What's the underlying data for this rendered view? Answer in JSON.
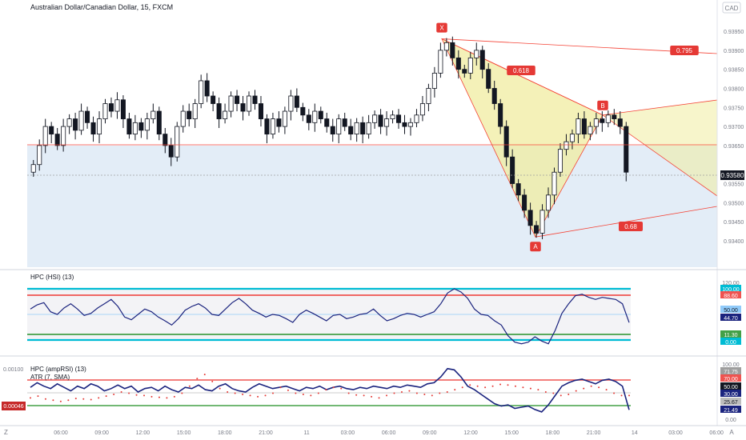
{
  "header": {
    "symbol_title": "Australian Dollar/Canadian Dollar, 15, FXCM",
    "currency": "CAD"
  },
  "main_pane": {
    "y_ticks": [
      "0.93950",
      "0.93900",
      "0.93850",
      "0.93800",
      "0.93750",
      "0.93700",
      "0.93650",
      "0.93550",
      "0.93500",
      "0.93450",
      "0.93400"
    ],
    "last_price": "0.93580",
    "pattern_points": {
      "X": "X",
      "A": "A",
      "B": "B"
    },
    "ratios": {
      "xab": "0.618",
      "c1": "0.795",
      "c2": "0.68"
    }
  },
  "hsi_pane": {
    "title": "HPC (HSI) (13)",
    "labels": [
      "120.00",
      "100.00",
      "88.60",
      "50.00",
      "44.70",
      "11.30",
      "0.00"
    ]
  },
  "amp_pane": {
    "title": "HPC (ampRSI) (13)",
    "atr_title": "ATR (7, SMA)",
    "atr_top": "0.00100",
    "atr_value": "0.00046",
    "labels": [
      "100.00",
      "71.75",
      "70.00",
      "50.00",
      "30.00",
      "25.67",
      "21.49",
      "0.00"
    ]
  },
  "time_axis": {
    "ticks": [
      "06:00",
      "09:00",
      "12:00",
      "15:00",
      "18:00",
      "21:00",
      "11",
      "03:00",
      "06:00",
      "09:00",
      "12:00",
      "15:00",
      "18:00",
      "21:00",
      "14",
      "03:00",
      "06:00"
    ],
    "left_corner": "Z",
    "right_corner": "A"
  },
  "colors": {
    "up_candle": "#ffffff",
    "down_candle": "#131722",
    "pattern_fill": "#f0eca0",
    "pattern_line": "#f44336",
    "zone_fill": "#e3edf7",
    "hsi_line": "#1a237e",
    "level_cyan": "#00bcd4",
    "level_red": "#ef5350",
    "level_green": "#43a047",
    "atr_dots": "#e53935"
  },
  "chart_data": [
    {
      "type": "candlestick",
      "title": "Australian Dollar/Canadian Dollar, 15, FXCM",
      "ylim": [
        0.9336,
        0.9399
      ],
      "x_range": [
        0,
        860
      ],
      "last": 0.9358,
      "horizontal_line": 0.93655,
      "series": [
        {
          "name": "price",
          "values": [
            0.936,
            0.9365,
            0.937,
            0.9368,
            0.9365,
            0.937,
            0.9372,
            0.9369,
            0.9374,
            0.9371,
            0.9368,
            0.9372,
            0.9376,
            0.9374,
            0.9377,
            0.9372,
            0.9368,
            0.9371,
            0.9369,
            0.9372,
            0.9374,
            0.9368,
            0.9365,
            0.9362,
            0.937,
            0.9374,
            0.9372,
            0.9376,
            0.9382,
            0.9378,
            0.9376,
            0.9372,
            0.9374,
            0.9378,
            0.9376,
            0.9374,
            0.9378,
            0.9376,
            0.9372,
            0.9368,
            0.9372,
            0.937,
            0.9374,
            0.9378,
            0.9375,
            0.9373,
            0.9371,
            0.9374,
            0.9372,
            0.937,
            0.9368,
            0.9372,
            0.937,
            0.9368,
            0.9371,
            0.9368,
            0.9371,
            0.9373,
            0.937,
            0.9372,
            0.9373,
            0.9371,
            0.937,
            0.9371,
            0.9373,
            0.9376,
            0.938,
            0.9384,
            0.939,
            0.9392,
            0.9388,
            0.9385,
            0.9384,
            0.9388,
            0.939,
            0.9385,
            0.938,
            0.9376,
            0.937,
            0.9362,
            0.9355,
            0.9352,
            0.9348,
            0.9344,
            0.9342,
            0.9348,
            0.9352,
            0.9358,
            0.9364,
            0.9366,
            0.9368,
            0.9372,
            0.9368,
            0.937,
            0.9372,
            0.9371,
            0.9373,
            0.9372,
            0.937,
            0.9358
          ]
        }
      ],
      "pattern": [
        {
          "point": "X",
          "x": 552,
          "price": 0.9393
        },
        {
          "point": "A",
          "x": 669,
          "price": 0.9341
        },
        {
          "point": "B",
          "x": 753,
          "price": 0.9373
        }
      ]
    },
    {
      "type": "line",
      "title": "HPC (HSI) (13)",
      "ylim": [
        0,
        120
      ],
      "levels": [
        100,
        88.6,
        50,
        11.3,
        0
      ],
      "series": [
        {
          "name": "HSI",
          "values": [
            70,
            78,
            82,
            65,
            60,
            72,
            80,
            70,
            58,
            62,
            72,
            80,
            88,
            75,
            55,
            50,
            60,
            70,
            65,
            55,
            48,
            40,
            52,
            68,
            75,
            80,
            72,
            60,
            58,
            70,
            82,
            90,
            80,
            68,
            62,
            55,
            60,
            58,
            52,
            45,
            60,
            68,
            62,
            55,
            48,
            58,
            60,
            52,
            55,
            60,
            62,
            70,
            58,
            48,
            52,
            58,
            62,
            60,
            55,
            60,
            65,
            80,
            100,
            108,
            102,
            90,
            70,
            60,
            58,
            48,
            40,
            20,
            8,
            5,
            8,
            18,
            10,
            5,
            30,
            62,
            80,
            95,
            98,
            92,
            88,
            92,
            90,
            88,
            80,
            44.7
          ]
        }
      ]
    },
    {
      "type": "line",
      "title": "HPC (ampRSI) (13)",
      "ylim": [
        0,
        100
      ],
      "levels": [
        70,
        50,
        30
      ],
      "series": [
        {
          "name": "ampRSI",
          "values": [
            60,
            68,
            62,
            58,
            66,
            60,
            54,
            62,
            58,
            66,
            62,
            54,
            58,
            64,
            58,
            62,
            52,
            58,
            60,
            54,
            62,
            56,
            52,
            60,
            58,
            64,
            56,
            54,
            62,
            66,
            58,
            54,
            52,
            60,
            66,
            62,
            58,
            60,
            62,
            58,
            54,
            60,
            58,
            62,
            56,
            60,
            62,
            58,
            56,
            60,
            58,
            62,
            60,
            58,
            62,
            60,
            64,
            62,
            60,
            66,
            68,
            78,
            92,
            90,
            78,
            62,
            56,
            48,
            40,
            32,
            28,
            30,
            24,
            26,
            28,
            22,
            18,
            30,
            46,
            62,
            68,
            72,
            74,
            70,
            66,
            72,
            74,
            70,
            62,
            21.49
          ]
        },
        {
          "name": "ATR (7, SMA)",
          "values": [
            0.00042,
            0.00045,
            0.0004,
            0.00038,
            0.00036,
            0.00038,
            0.00041,
            0.0004,
            0.00039,
            0.00042,
            0.00045,
            0.00048,
            0.00052,
            0.0005,
            0.00047,
            0.00046,
            0.00044,
            0.00043,
            0.00042,
            0.00044,
            0.0005,
            0.00062,
            0.00075,
            0.00082,
            0.0007,
            0.00058,
            0.00052,
            0.0005,
            0.00048,
            0.00046,
            0.00044,
            0.00046,
            0.0005,
            0.0006,
            0.00055,
            0.0005,
            0.00048,
            0.00046,
            0.0005,
            0.00056,
            0.0006,
            0.00058,
            0.0005,
            0.00047,
            0.00046,
            0.00044,
            0.00042,
            0.00046,
            0.0005,
            0.00052,
            0.00054,
            0.0005,
            0.00048,
            0.00046,
            0.0005,
            0.00052,
            0.00056,
            0.0006,
            0.00064,
            0.00062,
            0.0006,
            0.00062,
            0.00065,
            0.00064,
            0.00062,
            0.0006,
            0.00058,
            0.00056,
            0.00052,
            0.0005,
            0.00046,
            0.00048,
            0.00054,
            0.00058,
            0.00062,
            0.0006,
            0.00056,
            0.0005,
            0.00046,
            0.00046
          ]
        }
      ]
    }
  ]
}
